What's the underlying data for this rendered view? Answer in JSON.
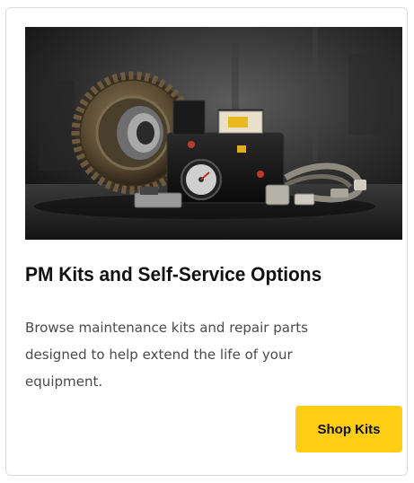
{
  "card": {
    "title": "PM Kits and Self-Service Options",
    "description": "Browse maintenance kits and repair parts designed to help extend the life of your equipment.",
    "button_label": "Shop Kits"
  },
  "colors": {
    "button_bg": "#ffcd11",
    "title": "#111111",
    "body_text": "#4a4a4a",
    "card_border": "#dcdcdc"
  },
  "icons": {
    "hero": "maintenance-parts-photo"
  }
}
